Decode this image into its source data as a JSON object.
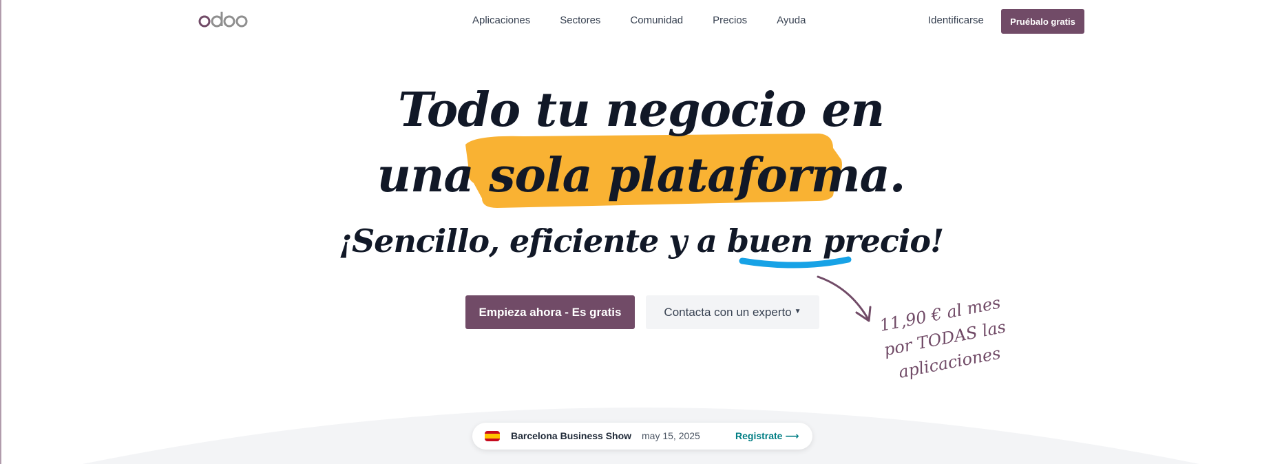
{
  "header": {
    "logo_text": "odoo",
    "nav": [
      "Aplicaciones",
      "Sectores",
      "Comunidad",
      "Precios",
      "Ayuda"
    ],
    "signin_label": "Identificarse",
    "try_label": "Pruébalo gratis"
  },
  "hero": {
    "line1": "Todo tu negocio en",
    "line2": "una sola plataforma.",
    "line3": "¡Sencillo, eficiente y a buen precio!",
    "cta_primary": "Empieza ahora - Es gratis",
    "cta_secondary": "Contacta con un experto",
    "price_line1": "11,90 € al mes",
    "price_line2": "por TODAS las aplicaciones"
  },
  "event": {
    "name": "Barcelona Business Show",
    "date": "may 15, 2025",
    "link": "Registrate ⟶"
  },
  "colors": {
    "brand": "#714b67",
    "highlight": "#f9b233",
    "underline": "#17a2e6",
    "link": "#017e84",
    "arc": "#f3f4f6"
  }
}
